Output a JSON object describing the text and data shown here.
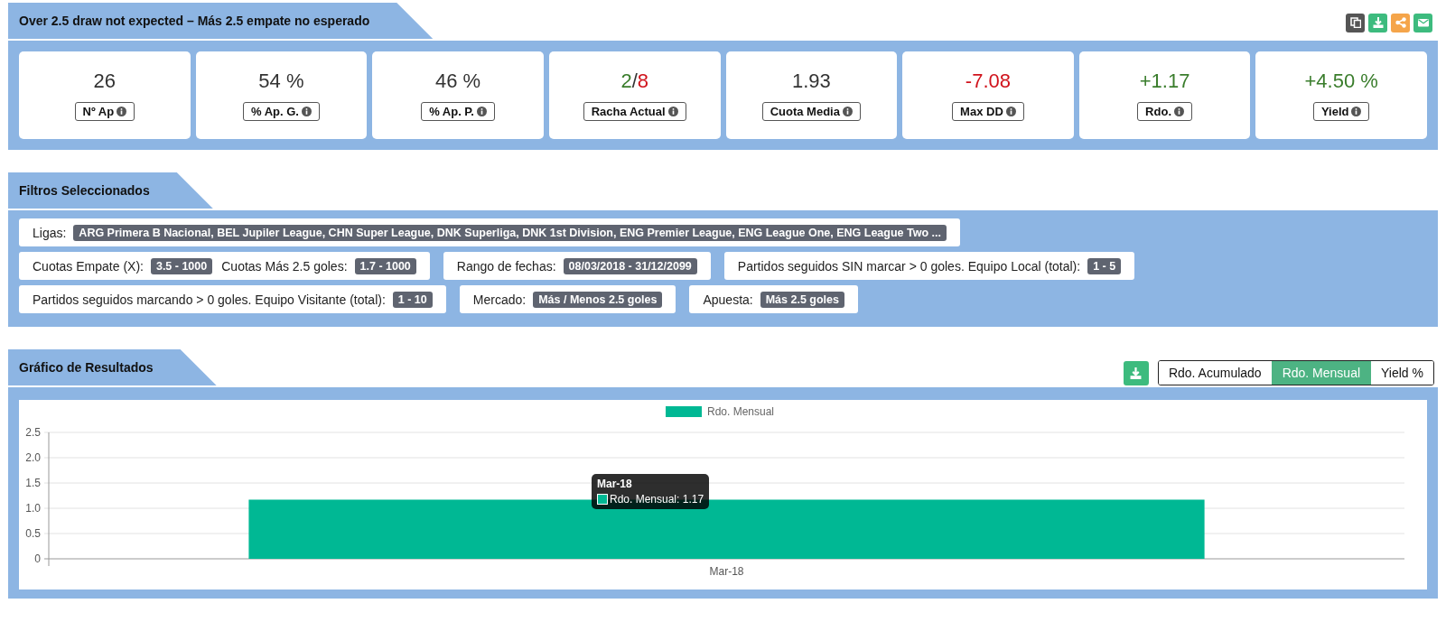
{
  "summary": {
    "title": "Over 2.5 draw not expected – Más 2.5 empate no esperado",
    "actions": [
      {
        "kind": "copy"
      },
      {
        "kind": "download"
      },
      {
        "kind": "share"
      },
      {
        "kind": "email"
      }
    ],
    "stats": [
      {
        "label": "Nº Ap",
        "value_parts": [
          {
            "text": "26",
            "color": "#333333"
          }
        ]
      },
      {
        "label": "% Ap. G.",
        "value_parts": [
          {
            "text": "54 %",
            "color": "#333333"
          }
        ]
      },
      {
        "label": "% Ap. P.",
        "value_parts": [
          {
            "text": "46 %",
            "color": "#333333"
          }
        ]
      },
      {
        "label": "Racha Actual",
        "value_parts": [
          {
            "text": "2",
            "color": "#3a7d2c"
          },
          {
            "text": "/",
            "color": "#333333"
          },
          {
            "text": "8",
            "color": "#d0121b"
          }
        ]
      },
      {
        "label": "Cuota Media",
        "value_parts": [
          {
            "text": "1.93",
            "color": "#333333"
          }
        ]
      },
      {
        "label": "Max DD",
        "value_parts": [
          {
            "text": "-7.08",
            "color": "#d0121b"
          }
        ]
      },
      {
        "label": "Rdo.",
        "value_parts": [
          {
            "text": "+1.17",
            "color": "#3a7d2c"
          }
        ]
      },
      {
        "label": "Yield",
        "value_parts": [
          {
            "text": "+4.50 %",
            "color": "#3a7d2c"
          }
        ]
      }
    ]
  },
  "filters": {
    "title": "Filtros Seleccionados",
    "rows": [
      [
        {
          "items": [
            {
              "label": "Ligas:",
              "value": "ARG Primera B Nacional, BEL Jupiler League, CHN Super League, DNK Superliga, DNK 1st Division, ENG Premier League, ENG League One, ENG League Two ..."
            }
          ]
        }
      ],
      [
        {
          "items": [
            {
              "label": "Cuotas Empate (X):",
              "value": "3.5 - 1000"
            },
            {
              "label": "Cuotas Más 2.5 goles:",
              "value": "1.7 - 1000"
            }
          ]
        },
        {
          "items": [
            {
              "label": "Rango de fechas:",
              "value": "08/03/2018 - 31/12/2099"
            }
          ]
        },
        {
          "items": [
            {
              "label": "Partidos seguidos SIN marcar > 0 goles. Equipo Local (total):",
              "value": "1 - 5"
            }
          ]
        }
      ],
      [
        {
          "items": [
            {
              "label": "Partidos seguidos marcando > 0 goles. Equipo Visitante (total):",
              "value": "1 - 10"
            }
          ]
        },
        {
          "items": [
            {
              "label": "Mercado:",
              "value": "Más / Menos 2.5 goles"
            }
          ]
        },
        {
          "items": [
            {
              "label": "Apuesta:",
              "value": "Más 2.5 goles"
            }
          ]
        }
      ]
    ]
  },
  "results": {
    "title": "Gráfico de Resultados",
    "actions": [
      {
        "kind": "download"
      }
    ],
    "views": [
      {
        "label": "Rdo. Acumulado",
        "selected": false
      },
      {
        "label": "Rdo. Mensual",
        "selected": true
      },
      {
        "label": "Yield %",
        "selected": false
      }
    ],
    "chart_data": {
      "type": "bar",
      "categories": [
        "Mar-18"
      ],
      "series": [
        {
          "name": "Rdo. Mensual",
          "color": "#00b894",
          "values": [
            1.17
          ]
        }
      ],
      "ylim": [
        0,
        2.5
      ],
      "grid": true,
      "yticks": [
        {
          "value": 0,
          "label": "0"
        },
        {
          "value": 0.5,
          "label": "0.5"
        },
        {
          "value": 1,
          "label": "1.0"
        },
        {
          "value": 1.5,
          "label": "1.5"
        },
        {
          "value": 2,
          "label": "2.0"
        },
        {
          "value": 2.5,
          "label": "2.5"
        }
      ]
    },
    "tooltip": {
      "title": "Mar-18",
      "text": "Rdo. Mensual: 1.17"
    }
  }
}
